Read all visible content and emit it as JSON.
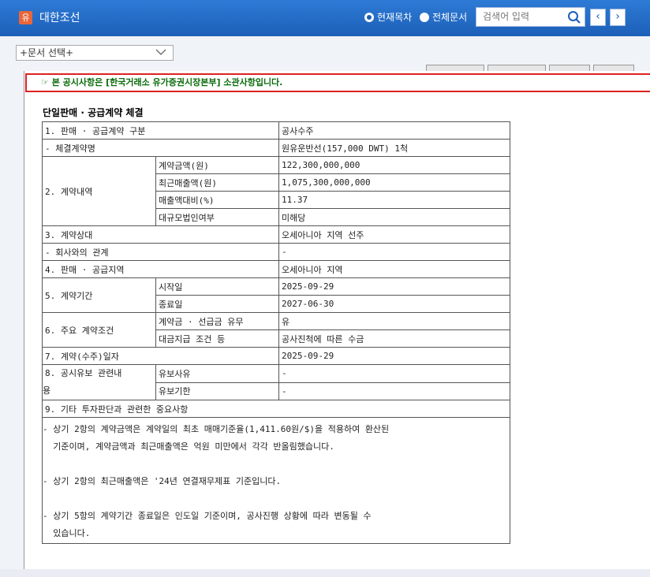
{
  "header": {
    "logo_glyph": "유",
    "company": "대한조선",
    "radio_current": "현재목차",
    "radio_all": "전체문서",
    "search_placeholder": "검색어 입력",
    "prev_glyph": "‹",
    "next_glyph": "›"
  },
  "doc_select": {
    "value": "+문서 선택+"
  },
  "notice": {
    "text": "☞ 본 공시사항은 [한국거래소 유가증권시장본부] 소관사항입니다."
  },
  "doc": {
    "title": "단일판매 · 공급계약 체결",
    "rows": {
      "r1_label": "1. 판매 · 공급계약 구분",
      "r1_value": "공사수주",
      "r2_label": "- 체결계약명",
      "r2_value": "원유운반선(157,000 DWT) 1척",
      "r3_label": "2. 계약내역",
      "r3a_sub": "계약금액(원)",
      "r3a_value": "122,300,000,000",
      "r3b_sub": "최근매출액(원)",
      "r3b_value": "1,075,300,000,000",
      "r3c_sub": "매출액대비(%)",
      "r3c_value": "11.37",
      "r3d_sub": "대규모법인여부",
      "r3d_value": "미해당",
      "r4_label": "3. 계약상대",
      "r4_value": "오세아니아 지역 선주",
      "r5_label": "- 회사와의 관계",
      "r5_value": "-",
      "r6_label": "4. 판매 · 공급지역",
      "r6_value": "오세아니아 지역",
      "r7_label": "5. 계약기간",
      "r7a_sub": "시작일",
      "r7a_value": "2025-09-29",
      "r7b_sub": "종료일",
      "r7b_value": "2027-06-30",
      "r8_label": "6. 주요 계약조건",
      "r8a_sub": "계약금 · 선급금 유무",
      "r8a_value": "유",
      "r8b_sub": "대금지급 조건 등",
      "r8b_value": "공사진척에 따른 수금",
      "r9_label": "7. 계약(수주)일자",
      "r9_value": "2025-09-29",
      "r10_label_line1": "8. 공시유보 관련내",
      "r10_label_line2": "용",
      "r10a_sub": "유보사유",
      "r10a_value": "-",
      "r10b_sub": "유보기한",
      "r10b_value": "-",
      "r11_label": "9. 기타 투자판단과 관련한 중요사항"
    },
    "notes": {
      "n1_line1": "- 상기 2항의 계약금액은 계약일의 최초 매매기준율(1,411.60원/$)을 적용하여 환산된",
      "n1_line2": "  기준이며, 계약금액과 최근매출액은 억원 미만에서 각각 반올림했습니다.",
      "n2": "- 상기 2항의 최근매출액은 '24년 연결재무제표 기준입니다.",
      "n3_line1": "- 상기 5항의 계약기간 종료일은 인도일 기준이며, 공사진행 상황에 따라 변동될 수",
      "n3_line2": "  있습니다."
    }
  }
}
